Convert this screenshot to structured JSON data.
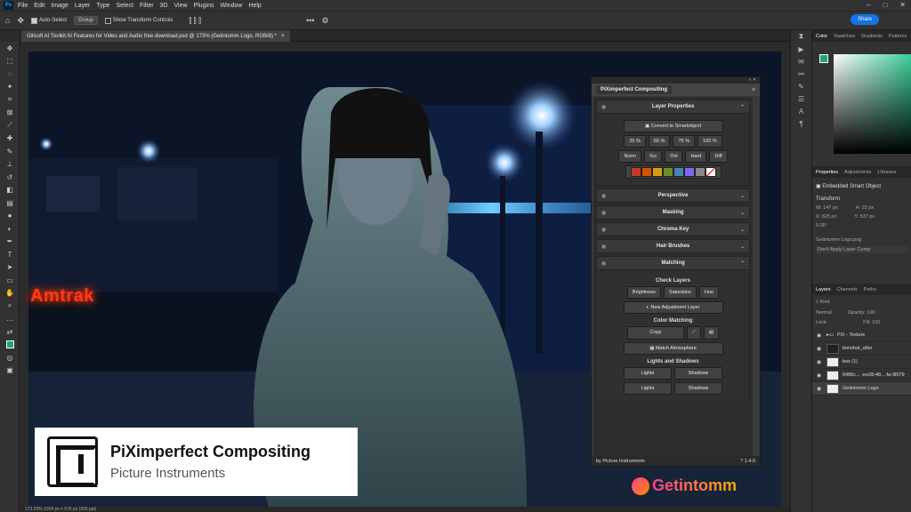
{
  "menubar": {
    "logo": "Ps",
    "items": [
      "File",
      "Edit",
      "Image",
      "Layer",
      "Type",
      "Select",
      "Filter",
      "3D",
      "View",
      "Plugins",
      "Window",
      "Help"
    ]
  },
  "options": {
    "auto_select": "Auto-Select",
    "group_value": "Group",
    "show_transform": "Show Transform Controls",
    "share": "Share"
  },
  "document": {
    "tab_title": "Gilisoft AI Toolkit AI Features for Video and Audio free download.psd @ 173% (Getintomm Logo, RGB/8) *",
    "close": "×",
    "status": "173.03%     1024 px x 576 px (300 ppi)"
  },
  "canvas_text": {
    "amtrak": "Amtrak",
    "watermark": "Getintomm"
  },
  "badge": {
    "title": "PiXimperfect Compositing",
    "subtitle": "Picture Instruments"
  },
  "plugin": {
    "title": "PiXimperfect Compositing",
    "layer_properties": {
      "header": "Layer Properties",
      "convert": "Convert to Smartobject",
      "opacity": [
        "25 %",
        "50 %",
        "75 %",
        "100 %"
      ],
      "blend": [
        "Norm",
        "Scr",
        "Ovl",
        "Hard",
        "Diff"
      ],
      "swatches": [
        "#c0392b",
        "#d35400",
        "#d4a017",
        "#6b8e23",
        "#4682b4",
        "#7b68ee",
        "#888888"
      ]
    },
    "collapsed": [
      "Perspective",
      "Masking",
      "Chroma Key",
      "Hair Brushes"
    ],
    "matching": {
      "header": "Matching",
      "check_layers": "Check Layers",
      "checks": [
        "Brightness",
        "Saturation",
        "Hue"
      ],
      "new_adjustment": "New Adjustment Layer",
      "color_matching": "Color Matching",
      "copy": "Copy",
      "match_atmosphere": "Match Atmosphere",
      "lights_shadows": "Lights and Shadows",
      "ls_buttons": [
        "Lights",
        "Shadows",
        "Lights",
        "Shadows"
      ]
    },
    "footer": {
      "by": "by Picture Instruments",
      "version": "1.4.0"
    }
  },
  "right_panel": {
    "color_tabs": [
      "Color",
      "Swatches",
      "Gradients",
      "Patterns"
    ],
    "prop_tabs": [
      "Properties",
      "Adjustments",
      "Libraries"
    ],
    "embedded": "Embedded Smart Object",
    "transform": "Transform",
    "w": "W: 147 px",
    "h": "H: 22 px",
    "x": "X: 825 px",
    "y": "Y: 537 px",
    "angle": "0.00°",
    "linked_file": "Getintomm Logo.png",
    "layer_comp": "Don't Apply Layer Comp",
    "layers_tabs": [
      "Layers",
      "Channels",
      "Paths"
    ],
    "kind": "Kind",
    "blend_mode": "Normal",
    "opacity": "Opacity: 100",
    "lock": "Lock:",
    "fill": "Fill: 100",
    "layers": [
      "PiX - Texture",
      "bonshot_after",
      "box (1)",
      "6486c... -ee28-48...-fa-9f079",
      "Getintomm Logo"
    ]
  }
}
